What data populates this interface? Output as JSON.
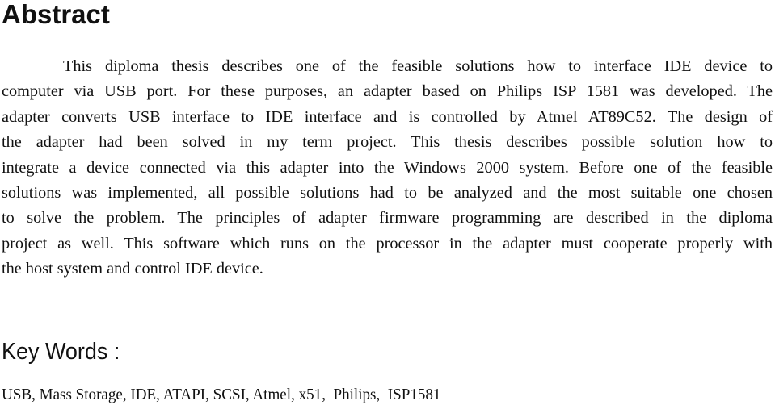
{
  "document": {
    "title": "Abstract",
    "abstract_lines": [
      "This diploma thesis describes one of the feasible solutions how to interface IDE device to",
      "computer via USB port. For these purposes, an adapter based on Philips ISP 1581 was developed. The",
      "adapter converts USB interface to IDE interface and is controlled by Atmel AT89C52. The design of",
      "the adapter had been solved in my term project. This thesis describes possible solution how to",
      "integrate a device connected via this adapter into the Windows 2000 system. Before one of the feasible",
      "solutions was implemented, all possible solutions had to be analyzed and the most suitable one chosen",
      "to solve the problem. The principles of adapter firmware programming are described in the diploma",
      "project as well. This software which runs on the processor in the adapter must cooperate properly with",
      "the host system and control IDE device."
    ],
    "keywords_heading": "Key Words :",
    "keywords": "USB, Mass Storage, IDE, ATAPI, SCSI, Atmel, x51,  Philips,  ISP1581"
  }
}
